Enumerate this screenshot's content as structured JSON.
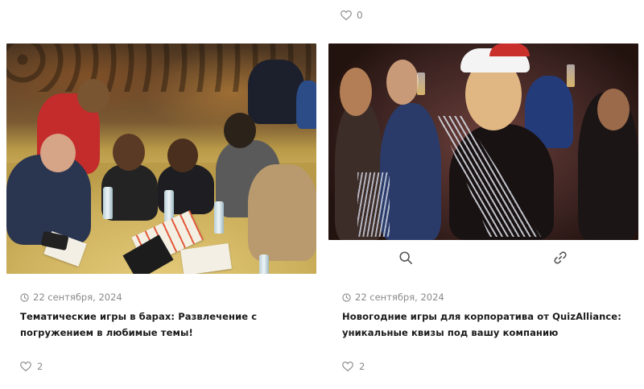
{
  "top_card": {
    "likes": "0"
  },
  "cards": [
    {
      "date": "22 сентября, 2024",
      "title": "Тематические игры в барах: Развлечение с погружением в любимые темы!",
      "likes": "2"
    },
    {
      "date": "22 сентября, 2024",
      "title": "Новогодние игры для корпоратива от QuizAlliance: уникальные квизы под вашу компанию",
      "likes": "2"
    }
  ],
  "icons": {
    "heart": "heart-icon",
    "clock": "clock-icon",
    "search": "search-icon",
    "link": "link-icon"
  },
  "colors": {
    "meta": "#8a8a8a",
    "title": "#1a1a1a",
    "icon": "#555555"
  }
}
